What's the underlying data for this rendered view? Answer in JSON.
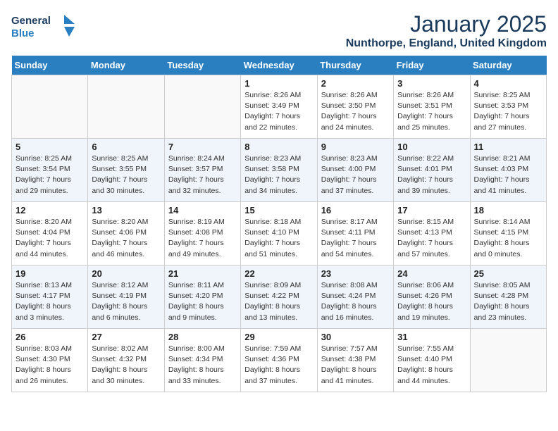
{
  "header": {
    "logo_general": "General",
    "logo_blue": "Blue",
    "month": "January 2025",
    "location": "Nunthorpe, England, United Kingdom"
  },
  "days_of_week": [
    "Sunday",
    "Monday",
    "Tuesday",
    "Wednesday",
    "Thursday",
    "Friday",
    "Saturday"
  ],
  "weeks": [
    [
      {
        "day": "",
        "info": ""
      },
      {
        "day": "",
        "info": ""
      },
      {
        "day": "",
        "info": ""
      },
      {
        "day": "1",
        "info": "Sunrise: 8:26 AM\nSunset: 3:49 PM\nDaylight: 7 hours\nand 22 minutes."
      },
      {
        "day": "2",
        "info": "Sunrise: 8:26 AM\nSunset: 3:50 PM\nDaylight: 7 hours\nand 24 minutes."
      },
      {
        "day": "3",
        "info": "Sunrise: 8:26 AM\nSunset: 3:51 PM\nDaylight: 7 hours\nand 25 minutes."
      },
      {
        "day": "4",
        "info": "Sunrise: 8:25 AM\nSunset: 3:53 PM\nDaylight: 7 hours\nand 27 minutes."
      }
    ],
    [
      {
        "day": "5",
        "info": "Sunrise: 8:25 AM\nSunset: 3:54 PM\nDaylight: 7 hours\nand 29 minutes."
      },
      {
        "day": "6",
        "info": "Sunrise: 8:25 AM\nSunset: 3:55 PM\nDaylight: 7 hours\nand 30 minutes."
      },
      {
        "day": "7",
        "info": "Sunrise: 8:24 AM\nSunset: 3:57 PM\nDaylight: 7 hours\nand 32 minutes."
      },
      {
        "day": "8",
        "info": "Sunrise: 8:23 AM\nSunset: 3:58 PM\nDaylight: 7 hours\nand 34 minutes."
      },
      {
        "day": "9",
        "info": "Sunrise: 8:23 AM\nSunset: 4:00 PM\nDaylight: 7 hours\nand 37 minutes."
      },
      {
        "day": "10",
        "info": "Sunrise: 8:22 AM\nSunset: 4:01 PM\nDaylight: 7 hours\nand 39 minutes."
      },
      {
        "day": "11",
        "info": "Sunrise: 8:21 AM\nSunset: 4:03 PM\nDaylight: 7 hours\nand 41 minutes."
      }
    ],
    [
      {
        "day": "12",
        "info": "Sunrise: 8:20 AM\nSunset: 4:04 PM\nDaylight: 7 hours\nand 44 minutes."
      },
      {
        "day": "13",
        "info": "Sunrise: 8:20 AM\nSunset: 4:06 PM\nDaylight: 7 hours\nand 46 minutes."
      },
      {
        "day": "14",
        "info": "Sunrise: 8:19 AM\nSunset: 4:08 PM\nDaylight: 7 hours\nand 49 minutes."
      },
      {
        "day": "15",
        "info": "Sunrise: 8:18 AM\nSunset: 4:10 PM\nDaylight: 7 hours\nand 51 minutes."
      },
      {
        "day": "16",
        "info": "Sunrise: 8:17 AM\nSunset: 4:11 PM\nDaylight: 7 hours\nand 54 minutes."
      },
      {
        "day": "17",
        "info": "Sunrise: 8:15 AM\nSunset: 4:13 PM\nDaylight: 7 hours\nand 57 minutes."
      },
      {
        "day": "18",
        "info": "Sunrise: 8:14 AM\nSunset: 4:15 PM\nDaylight: 8 hours\nand 0 minutes."
      }
    ],
    [
      {
        "day": "19",
        "info": "Sunrise: 8:13 AM\nSunset: 4:17 PM\nDaylight: 8 hours\nand 3 minutes."
      },
      {
        "day": "20",
        "info": "Sunrise: 8:12 AM\nSunset: 4:19 PM\nDaylight: 8 hours\nand 6 minutes."
      },
      {
        "day": "21",
        "info": "Sunrise: 8:11 AM\nSunset: 4:20 PM\nDaylight: 8 hours\nand 9 minutes."
      },
      {
        "day": "22",
        "info": "Sunrise: 8:09 AM\nSunset: 4:22 PM\nDaylight: 8 hours\nand 13 minutes."
      },
      {
        "day": "23",
        "info": "Sunrise: 8:08 AM\nSunset: 4:24 PM\nDaylight: 8 hours\nand 16 minutes."
      },
      {
        "day": "24",
        "info": "Sunrise: 8:06 AM\nSunset: 4:26 PM\nDaylight: 8 hours\nand 19 minutes."
      },
      {
        "day": "25",
        "info": "Sunrise: 8:05 AM\nSunset: 4:28 PM\nDaylight: 8 hours\nand 23 minutes."
      }
    ],
    [
      {
        "day": "26",
        "info": "Sunrise: 8:03 AM\nSunset: 4:30 PM\nDaylight: 8 hours\nand 26 minutes."
      },
      {
        "day": "27",
        "info": "Sunrise: 8:02 AM\nSunset: 4:32 PM\nDaylight: 8 hours\nand 30 minutes."
      },
      {
        "day": "28",
        "info": "Sunrise: 8:00 AM\nSunset: 4:34 PM\nDaylight: 8 hours\nand 33 minutes."
      },
      {
        "day": "29",
        "info": "Sunrise: 7:59 AM\nSunset: 4:36 PM\nDaylight: 8 hours\nand 37 minutes."
      },
      {
        "day": "30",
        "info": "Sunrise: 7:57 AM\nSunset: 4:38 PM\nDaylight: 8 hours\nand 41 minutes."
      },
      {
        "day": "31",
        "info": "Sunrise: 7:55 AM\nSunset: 4:40 PM\nDaylight: 8 hours\nand 44 minutes."
      },
      {
        "day": "",
        "info": ""
      }
    ]
  ]
}
